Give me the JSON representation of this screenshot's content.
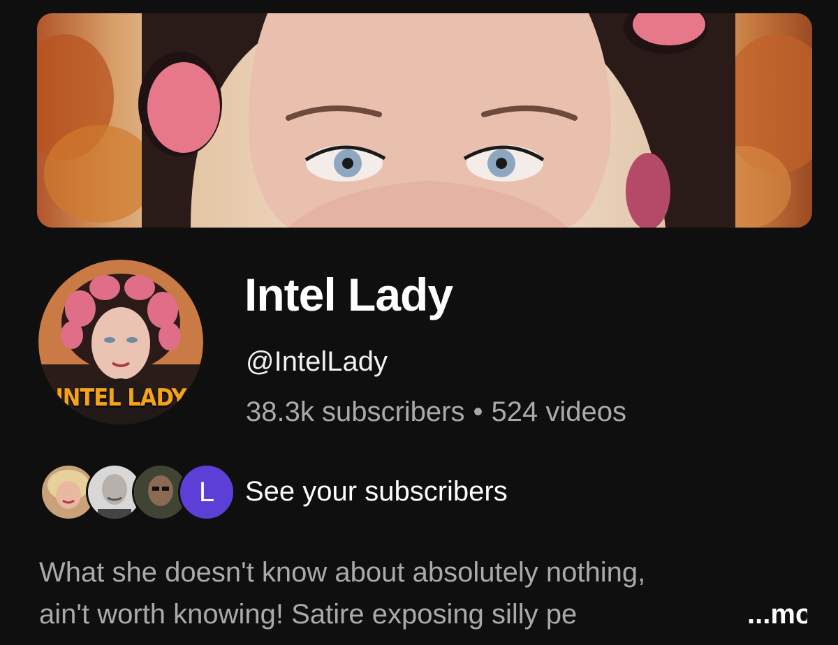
{
  "channel": {
    "name": "Intel Lady",
    "handle": "@IntelLady",
    "subscribers": "38.3k subscribers",
    "separator": "•",
    "videos": "524 videos",
    "avatar_logo_text": "INTEL LADY"
  },
  "subscribers_row": {
    "label": "See your subscribers",
    "avatars": [
      {
        "icon": "subscriber-photo-icon"
      },
      {
        "icon": "subscriber-photo-icon"
      },
      {
        "icon": "subscriber-photo-icon"
      },
      {
        "initial": "L"
      }
    ]
  },
  "description": {
    "line1": "What she doesn't know about absolutely nothing,",
    "line2": "ain't worth knowing!  Satire exposing silly pe",
    "more_label": "...more"
  },
  "colors": {
    "background": "#0f0f0f",
    "primary_text": "#f1f1f1",
    "secondary_text": "#aaaaaa",
    "logo_orange": "#f5a31a",
    "initial_avatar": "#5b3fd6"
  }
}
